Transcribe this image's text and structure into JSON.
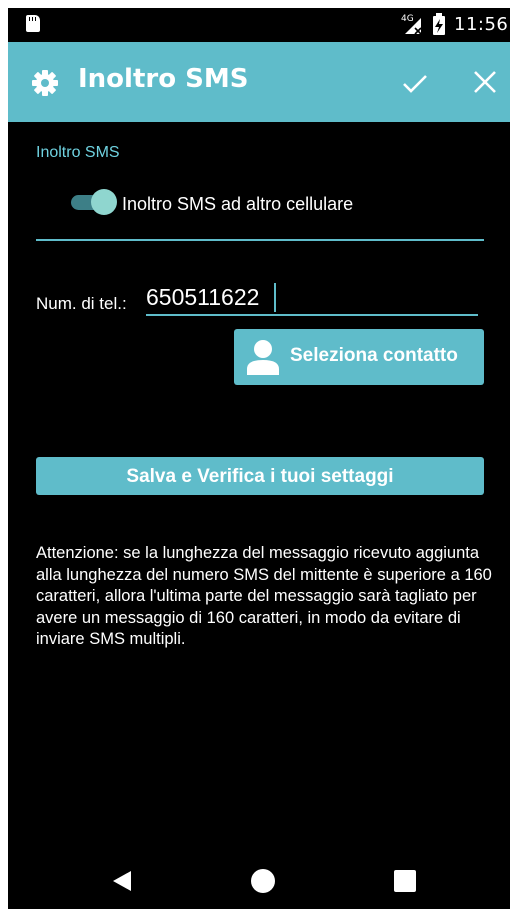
{
  "status_bar": {
    "time": "11:56",
    "network_label": "4G",
    "icons": [
      "sd-card-icon",
      "signal-icon",
      "battery-charging-icon"
    ]
  },
  "app_bar": {
    "title": "Inoltro SMS",
    "icons": [
      "gear-icon",
      "check-icon",
      "close-icon"
    ]
  },
  "section": {
    "label": "Inoltro SMS"
  },
  "forward_toggle": {
    "label": "Inoltro SMS ad altro cellulare",
    "checked": true
  },
  "phone": {
    "label": "Num. di tel.:",
    "value": "650511622"
  },
  "select_contact_button": {
    "label": "Seleziona contatto",
    "icon": "person-icon"
  },
  "save_button": {
    "label": "Salva e Verifica i tuoi settaggi"
  },
  "warning": {
    "text": "Attenzione: se la lunghezza del messaggio ricevuto aggiunta alla lunghezza del numero SMS del mittente è superiore a 160 caratteri, allora l'ultima parte del messaggio sarà tagliato per avere un messaggio di 160 caratteri, in modo da evitare di inviare SMS multipli."
  },
  "nav_bar": {
    "icons": [
      "back-icon",
      "home-icon",
      "recents-icon"
    ]
  },
  "colors": {
    "accent": "#5fbcca",
    "section_label": "#6fd2e0",
    "background": "#000000",
    "toggle_thumb": "#8fd6cf",
    "toggle_track": "#3d7f87"
  }
}
